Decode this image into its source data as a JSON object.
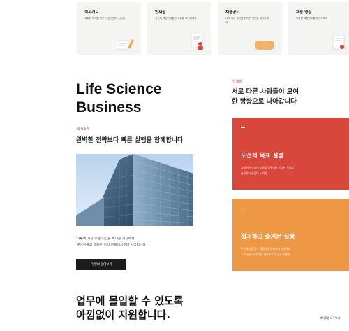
{
  "cards": [
    {
      "title": "회사개요",
      "subtitle": "새로운 미래를 여는 기업 만들어 갑니다"
    },
    {
      "title": "인재상",
      "subtitle": "기업의 핵심인재를 인재들을 확인하세요"
    },
    {
      "title": "채용공고",
      "subtitle": "나의 직업 찾아볼 원하는 직군을 확인하세요"
    },
    {
      "title": "채용 영상",
      "subtitle": "다양한 채용정보를 확인하세요"
    }
  ],
  "hero": {
    "title_line1": "Life Science",
    "title_line2": "Business",
    "tag": "회사소개",
    "subtitle": "완벽한 전략보다 빠른 실행을 함께합니다",
    "description_line1": "하루에 가장 오랜 시간을 보내는 회사에서",
    "description_line2": "구성원들의 행복은 기업 문화에서부터 시작됩니다.",
    "button_label": "더 알아 알아보기"
  },
  "right": {
    "tag": "인재상",
    "heading_line1": "서로 다른 사람들이 모여",
    "heading_line2": "한 방향으로 나아갑니다",
    "boxes": [
      {
        "title": "도전적 목표 설정",
        "line1": "기대수준 이상의 성과를 멤두하여 원대한 목표를",
        "line2": "설정하고 끝없이 노력합"
      },
      {
        "title": "철저하고 즐거운 실행",
        "line1": "주인의식을 갖고 적절하게 준비하여 수행하되",
        "line2": "그 과정은 일에 대한 열정으로 즐겁게 수행해"
      }
    ]
  },
  "bottom": {
    "title_line1": "업무에 몰입할 수 있도록",
    "title_line2": "아낌없이 지원합니다."
  },
  "corner_label": "복지후생 모두보기",
  "colors": {
    "accent_red": "#d9463c",
    "accent_orange": "#ee9745",
    "dark_button": "#1b1b1b"
  }
}
